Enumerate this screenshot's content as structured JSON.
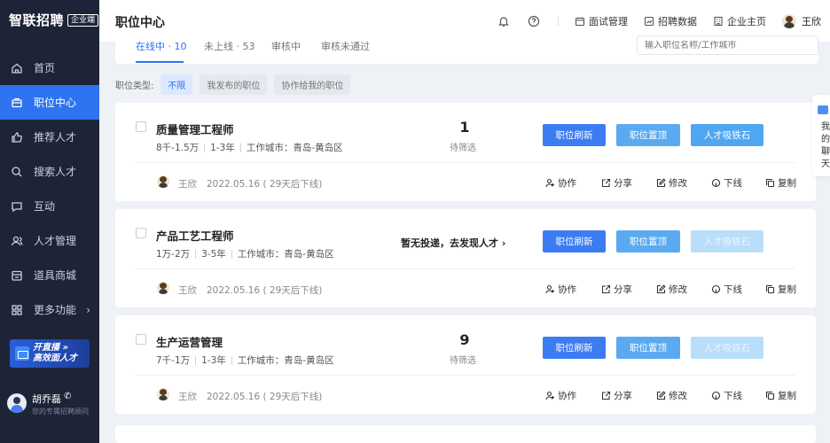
{
  "brand": {
    "name": "智联招聘",
    "badge": "企业端"
  },
  "nav": [
    {
      "label": "首页",
      "icon": "home-icon"
    },
    {
      "label": "职位中心",
      "icon": "briefcase-icon",
      "active": true
    },
    {
      "label": "推荐人才",
      "icon": "thumbs-up-icon"
    },
    {
      "label": "搜索人才",
      "icon": "search-icon"
    },
    {
      "label": "互动",
      "icon": "chat-icon"
    },
    {
      "label": "人才管理",
      "icon": "users-icon"
    },
    {
      "label": "道具商城",
      "icon": "store-icon"
    },
    {
      "label": "更多功能",
      "icon": "grid-icon",
      "arrow": "›"
    }
  ],
  "live_banner": {
    "line1": "开直播 »",
    "line2": "高效面人才"
  },
  "sidebar_user": {
    "name": "胡乔磊",
    "phone_icon": "phone-icon",
    "subtitle": "您的专属招聘顾问"
  },
  "header": {
    "title": "职位中心",
    "links": [
      "面试管理",
      "招聘数据",
      "企业主页"
    ],
    "username": "王欣"
  },
  "tabs": [
    {
      "label": "在线中 · 10",
      "active": true
    },
    {
      "label": "未上线 · 53"
    },
    {
      "label": "审核中"
    },
    {
      "label": "审核未通过"
    }
  ],
  "search": {
    "placeholder": "输入职位名称/工作城市"
  },
  "filters": {
    "label": "职位类型:",
    "chips": [
      "不限",
      "我发布的职位",
      "协作给我的职位"
    ]
  },
  "buttons": {
    "refresh": "职位刷新",
    "top": "职位置顶",
    "magnet": "人才吸铁石"
  },
  "actions": {
    "collab": "协作",
    "share": "分享",
    "edit": "修改",
    "offline": "下线",
    "copy": "复制"
  },
  "jobs": [
    {
      "title": "质量管理工程师",
      "salary": "8千-1.5万",
      "experience": "1-3年",
      "city": "工作城市：青岛-黄岛区",
      "count": "1",
      "count_label": "待筛选",
      "magnet_enabled": true,
      "poster": "王欣",
      "date": "2022.05.16 ( 29天后下线)"
    },
    {
      "title": "产品工艺工程师",
      "salary": "1万-2万",
      "experience": "3-5年",
      "city": "工作城市：青岛-黄岛区",
      "discover": "暂无投递，去发现人才 ›",
      "magnet_enabled": false,
      "poster": "王欣",
      "date": "2022.05.16 ( 29天后下线)"
    },
    {
      "title": "生产运营管理",
      "salary": "7千-1万",
      "experience": "1-3年",
      "city": "工作城市：青岛-黄岛区",
      "count": "9",
      "count_label": "待筛选",
      "magnet_enabled": false,
      "poster": "王欣",
      "date": "2022.05.16 ( 29天后下线)"
    }
  ],
  "chat_float": {
    "text": "我的聊天"
  },
  "colors": {
    "primary": "#2e73f0",
    "sidebar_bg": "#1e2437",
    "magnet_disabled": "#b9defa"
  }
}
